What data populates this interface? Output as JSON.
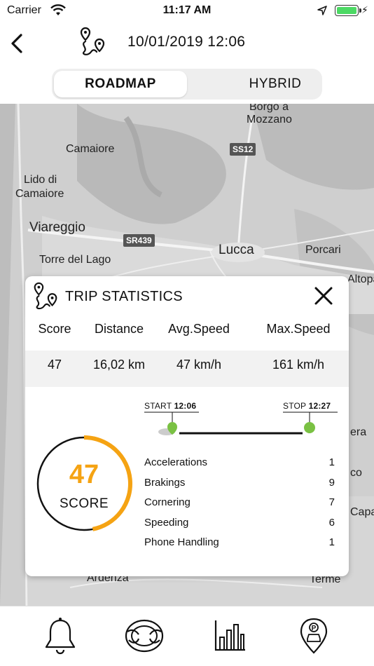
{
  "status": {
    "carrier": "Carrier",
    "time": "11:17 AM",
    "battery_level": 1.0
  },
  "nav": {
    "title": "10/01/2019 12:06",
    "back_icon": "chevron-left-icon",
    "trip_icon": "route-pins-icon"
  },
  "map_type": {
    "options": [
      "ROADMAP",
      "HYBRID"
    ],
    "selected": "ROADMAP"
  },
  "map": {
    "places": [
      "Borgo a",
      "Mozzano",
      "Camaiore",
      "Lido di",
      "Camaiore",
      "Viareggio",
      "Torre del Lago",
      "Lucca",
      "Porcari",
      "Altopas",
      "Ardenza",
      "Terme",
      "era",
      "co",
      "Capar"
    ],
    "roads": [
      "SS12",
      "SR439"
    ]
  },
  "trip": {
    "title": "TRIP STATISTICS",
    "columns": [
      "Score",
      "Distance",
      "Avg.Speed",
      "Max.Speed"
    ],
    "values": [
      "47",
      "16,02 km",
      "47 km/h",
      "161 km/h"
    ],
    "start_label": "START",
    "start_time": "12:06",
    "stop_label": "STOP",
    "stop_time": "12:27",
    "score": "47",
    "score_label": "SCORE",
    "score_fraction": 0.47,
    "events": [
      {
        "name": "Accelerations",
        "count": "1"
      },
      {
        "name": "Brakings",
        "count": "9"
      },
      {
        "name": "Cornering",
        "count": "7"
      },
      {
        "name": "Speeding",
        "count": "6"
      },
      {
        "name": "Phone Handling",
        "count": "1"
      }
    ]
  },
  "tabbar": {
    "tabs": [
      "bell-icon",
      "steering-wheel-icon",
      "bar-chart-icon",
      "parking-pin-icon"
    ]
  },
  "colors": {
    "accent": "#f5a313",
    "pin": "#7ac143",
    "map": "#cfcfcf"
  }
}
